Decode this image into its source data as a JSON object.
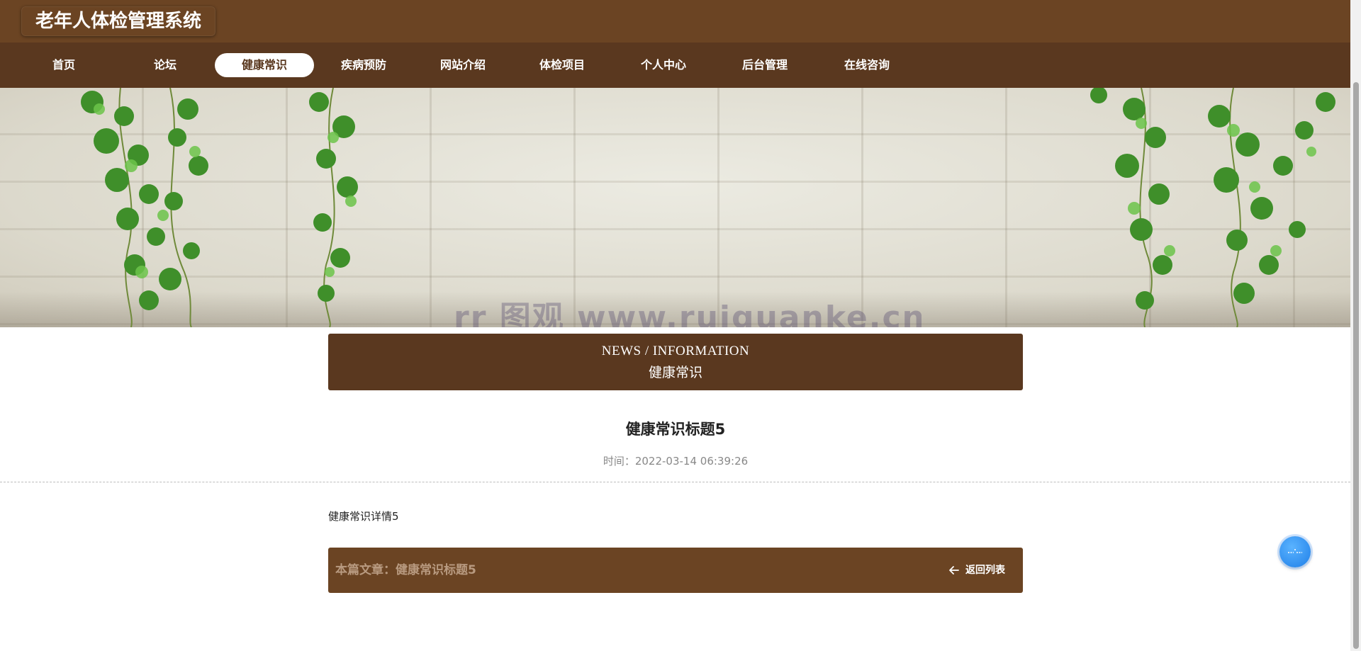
{
  "header": {
    "title": "老年人体检管理系统"
  },
  "nav": {
    "items": [
      {
        "label": "首页",
        "active": false
      },
      {
        "label": "论坛",
        "active": false
      },
      {
        "label": "健康常识",
        "active": true
      },
      {
        "label": "疾病预防",
        "active": false
      },
      {
        "label": "网站介绍",
        "active": false
      },
      {
        "label": "体检项目",
        "active": false
      },
      {
        "label": "个人中心",
        "active": false
      },
      {
        "label": "后台管理",
        "active": false
      },
      {
        "label": "在线咨询",
        "active": false
      }
    ]
  },
  "banner": {
    "watermark": "rr 图观 www.ruiguanke.cn"
  },
  "section": {
    "en_title": "NEWS / INFORMATION",
    "cn_title": "健康常识"
  },
  "article": {
    "title": "健康常识标题5",
    "time_label": "时间：",
    "time": "2022-03-14 06:39:26",
    "body": "健康常识详情5",
    "current_label": "本篇文章：",
    "current_title": "健康常识标题5",
    "back_label": "返回列表"
  },
  "colors": {
    "header_bg": "#6b4423",
    "nav_bg": "#5a381f",
    "accent_blue": "#1f7fe8"
  },
  "icons": {
    "back": "arrow-left-icon",
    "float": "service-icon"
  }
}
